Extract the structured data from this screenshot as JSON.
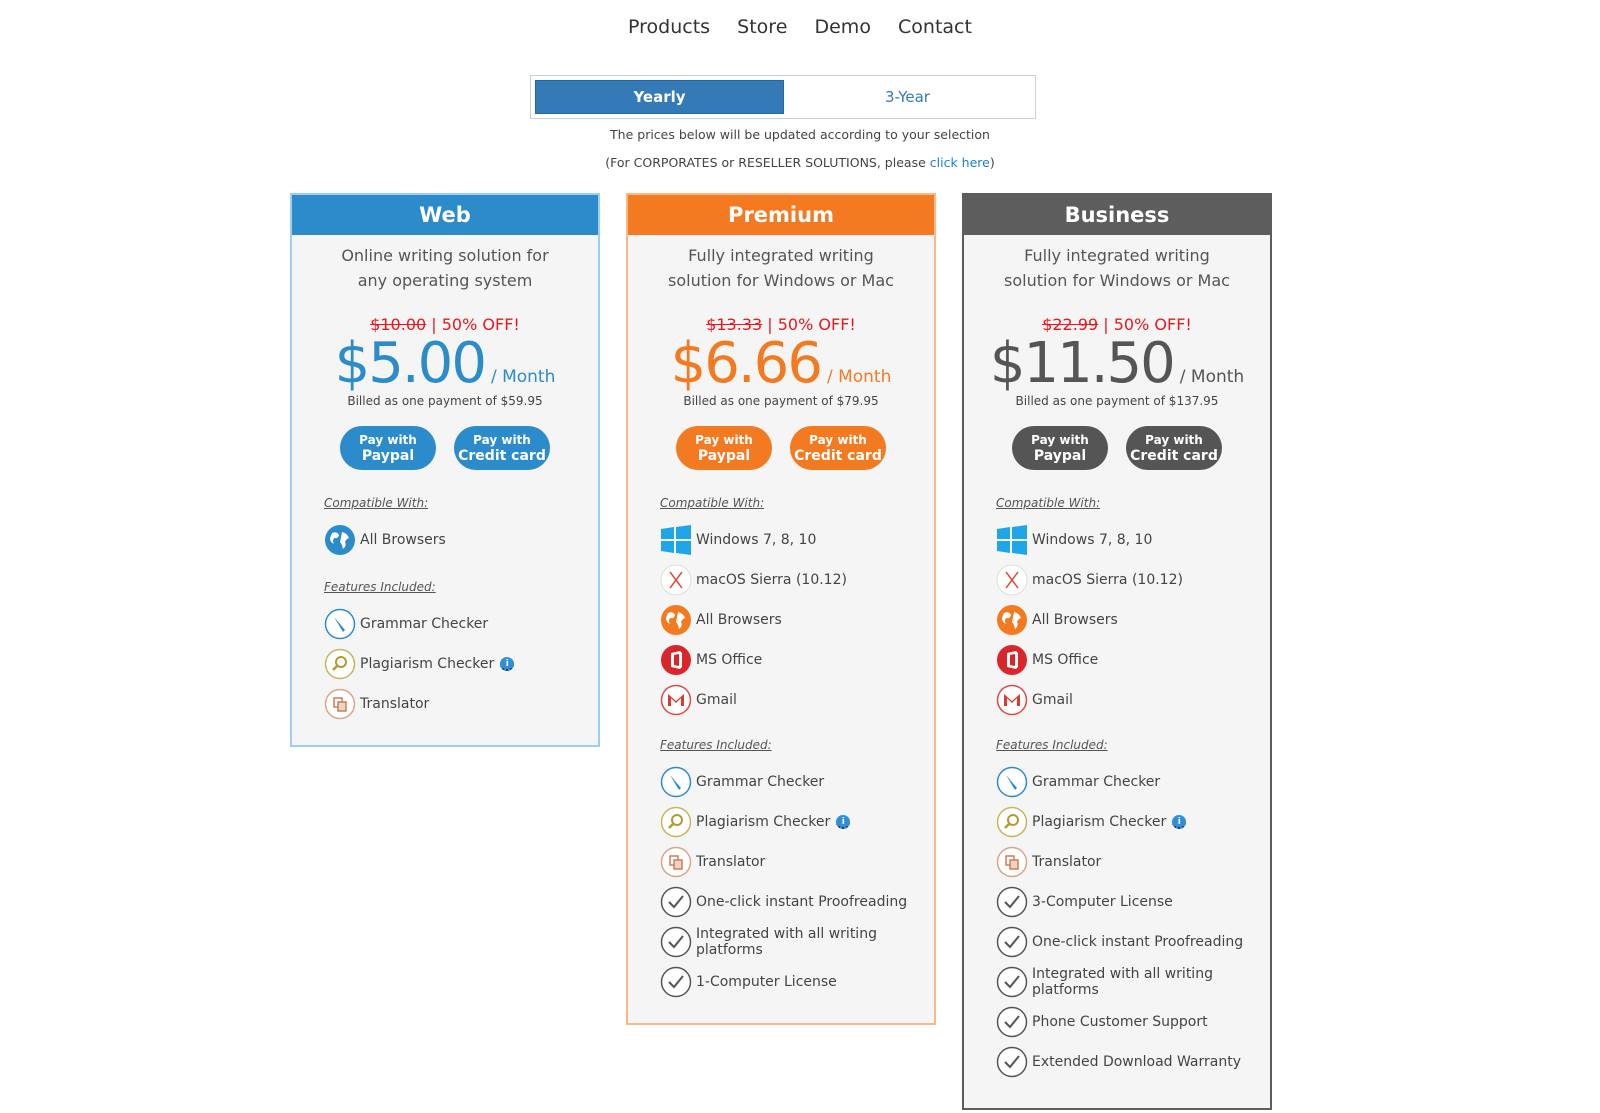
{
  "nav": {
    "items": [
      "Products",
      "Store",
      "Demo",
      "Contact"
    ]
  },
  "billing_toggle": {
    "yearly": "Yearly",
    "three_year": "3-Year",
    "selected": "Yearly"
  },
  "notes": {
    "line1": "The prices below will be updated according to your selection",
    "line2_prefix": "(For CORPORATES or RESELLER SOLUTIONS, please ",
    "line2_link": "click here",
    "line2_suffix": ")"
  },
  "labels": {
    "compatible_with": "Compatible With:",
    "features_included": "Features Included:",
    "pay_with": "Pay with",
    "paypal": "Paypal",
    "credit_card": "Credit card",
    "per_month": "/ Month",
    "off": "| 50% OFF!"
  },
  "plans": {
    "web": {
      "name": "Web",
      "desc1": "Online writing solution for",
      "desc2": "any operating system",
      "old_price": "$10.00",
      "price": "$5.00",
      "billed": "Billed as one payment of $59.95",
      "compatible": [
        "All Browsers"
      ],
      "features": [
        "Grammar Checker",
        "Plagiarism Checker",
        "Translator"
      ],
      "accent": "#2c8ccb"
    },
    "premium": {
      "name": "Premium",
      "desc1": "Fully integrated writing",
      "desc2": "solution for Windows or Mac",
      "old_price": "$13.33",
      "price": "$6.66",
      "billed": "Billed as one payment of $79.95",
      "compatible": [
        "Windows 7, 8, 10",
        "macOS Sierra (10.12)",
        "All Browsers",
        "MS Office",
        "Gmail"
      ],
      "features": [
        "Grammar Checker",
        "Plagiarism Checker",
        "Translator",
        "One-click instant Proofreading",
        "Integrated with all writing platforms",
        "1-Computer License"
      ],
      "accent": "#f37a21"
    },
    "business": {
      "name": "Business",
      "desc1": "Fully integrated writing",
      "desc2": "solution for Windows or Mac",
      "old_price": "$22.99",
      "price": "$11.50",
      "billed": "Billed as one payment of $137.95",
      "compatible": [
        "Windows 7, 8, 10",
        "macOS Sierra (10.12)",
        "All Browsers",
        "MS Office",
        "Gmail"
      ],
      "features": [
        "Grammar Checker",
        "Plagiarism Checker",
        "Translator",
        "3-Computer License",
        "One-click instant Proofreading",
        "Integrated with all writing platforms",
        "Phone Customer Support",
        "Extended Download Warranty"
      ],
      "accent": "#5d5d5d"
    }
  },
  "colors": {
    "discount_red": "#e8191c",
    "link_blue": "#1c7fd6"
  }
}
